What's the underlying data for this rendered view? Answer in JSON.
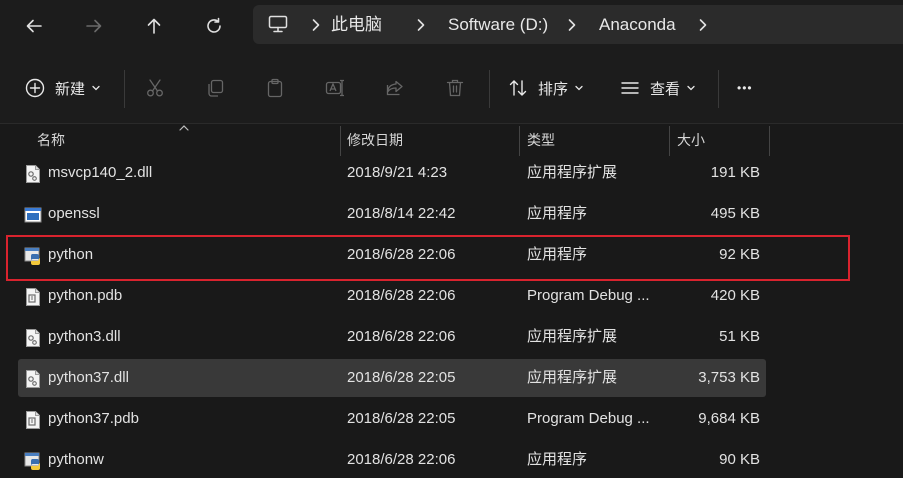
{
  "address": {
    "crumbs": [
      "此电脑",
      "Software (D:)",
      "Anaconda"
    ]
  },
  "toolbar": {
    "new_label": "新建",
    "sort_label": "排序",
    "view_label": "查看",
    "more_label": "•••"
  },
  "columns": {
    "name": "名称",
    "date": "修改日期",
    "type": "类型",
    "size": "大小"
  },
  "files": [
    {
      "name": "msvcp140_2.dll",
      "date": "2018/9/21 4:23",
      "type": "应用程序扩展",
      "size": "191 KB",
      "icon": "dll-gear-icon"
    },
    {
      "name": "openssl",
      "date": "2018/8/14 22:42",
      "type": "应用程序",
      "size": "495 KB",
      "icon": "exe-window-icon"
    },
    {
      "name": "python",
      "date": "2018/6/28 22:06",
      "type": "应用程序",
      "size": "92 KB",
      "icon": "python-exe-icon"
    },
    {
      "name": "python.pdb",
      "date": "2018/6/28 22:06",
      "type": "Program Debug ...",
      "size": "420 KB",
      "icon": "pdb-file-icon"
    },
    {
      "name": "python3.dll",
      "date": "2018/6/28 22:06",
      "type": "应用程序扩展",
      "size": "51 KB",
      "icon": "dll-gear-icon"
    },
    {
      "name": "python37.dll",
      "date": "2018/6/28 22:05",
      "type": "应用程序扩展",
      "size": "3,753 KB",
      "icon": "dll-gear-icon"
    },
    {
      "name": "python37.pdb",
      "date": "2018/6/28 22:05",
      "type": "Program Debug ...",
      "size": "9,684 KB",
      "icon": "pdb-file-icon"
    },
    {
      "name": "pythonw",
      "date": "2018/6/28 22:06",
      "type": "应用程序",
      "size": "90 KB",
      "icon": "python-exe-icon"
    }
  ],
  "selected_row": "python37.dll",
  "highlighted_row": "python",
  "colors": {
    "background": "#191919",
    "selection": "#393939",
    "highlight_border": "#d9232e"
  }
}
